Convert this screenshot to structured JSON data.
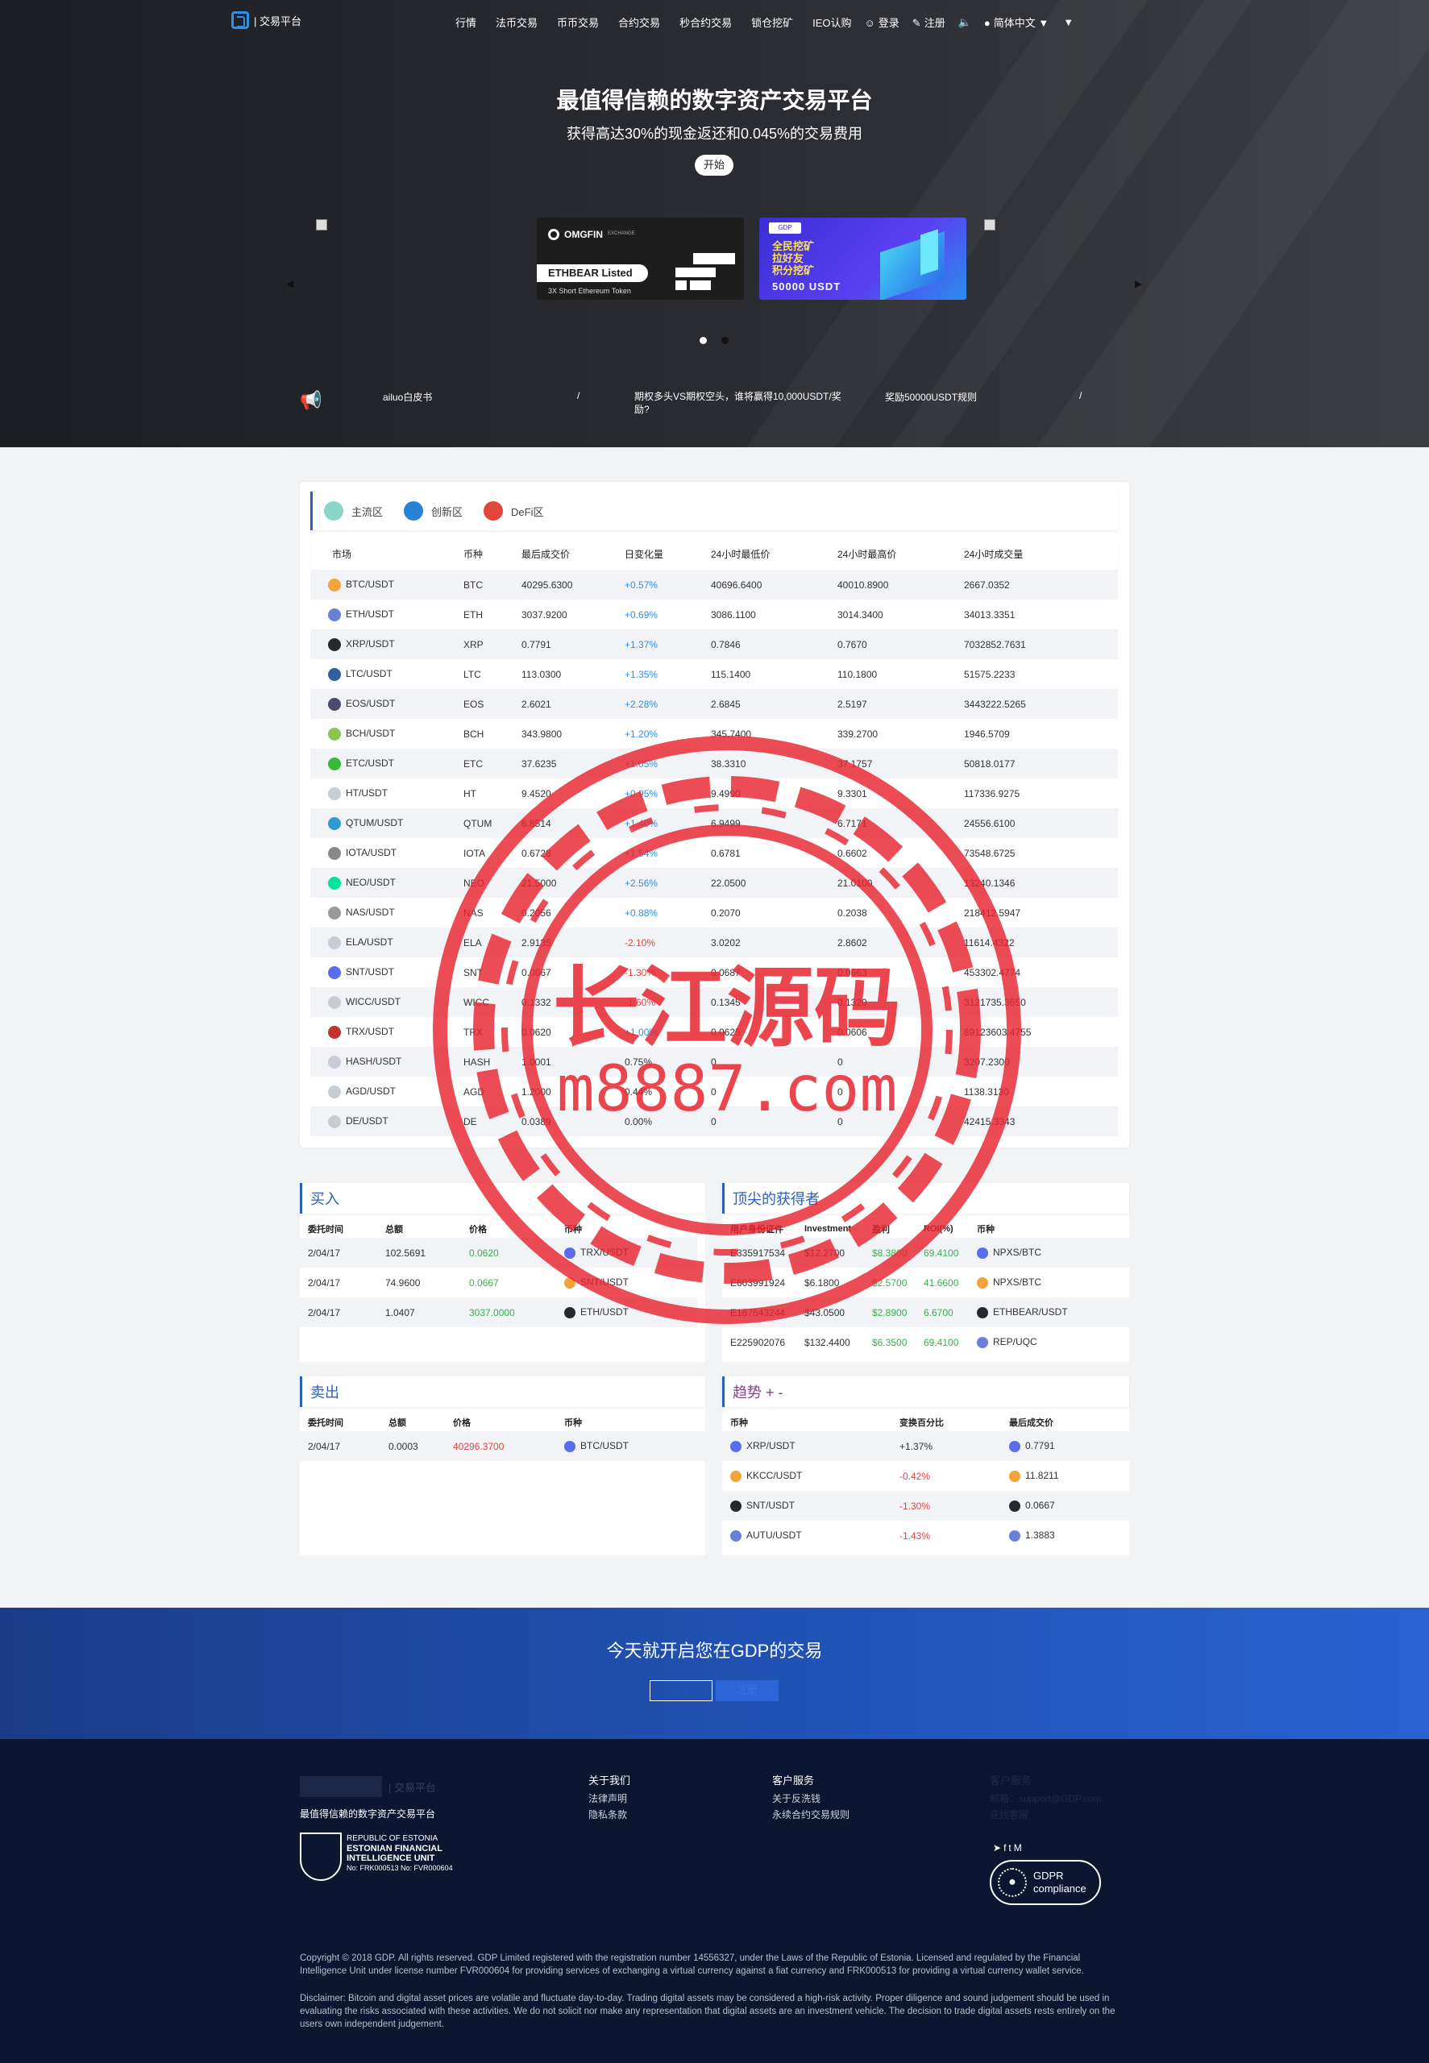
{
  "brand": {
    "name": "| 交易平台"
  },
  "nav": {
    "items": [
      "行情",
      "法币交易",
      "币币交易",
      "合约交易",
      "秒合约交易",
      "锁仓挖矿",
      "IEO认购"
    ],
    "login": "登录",
    "register": "注册",
    "language": "简体中文"
  },
  "hero": {
    "title": "最值得信赖的数字资产交易平台",
    "subtitle": "获得高达30%的现金返还和0.045%的交易费用",
    "start": "开始"
  },
  "banners": {
    "omgfin": {
      "brand": "OMGFIN",
      "tag": "EXCHANGE",
      "listed": "ETHBEAR Listed",
      "caption": "3X Short Ethereum Token"
    },
    "mining": {
      "line1": "全民挖矿",
      "line2": "拉好友",
      "line3": "积分挖矿",
      "line4": "50000 USDT",
      "badge": "GDP"
    }
  },
  "notices": [
    "ailuo白皮书",
    "/",
    "期权多头VS期权空头，谁将赢得10,000USDT/奖励?",
    "奖励50000USDT规则",
    "/"
  ],
  "zones": [
    "主流区",
    "创新区",
    "DeFi区"
  ],
  "market": {
    "headers": [
      "市场",
      "币种",
      "最后成交价",
      "日变化量",
      "24小时最低价",
      "24小时最高价",
      "24小时成交量"
    ],
    "rows": [
      {
        "pair": "BTC/USDT",
        "coin": "BTC",
        "last": "40295.6300",
        "change": "+0.57%",
        "low": "40696.6400",
        "high": "40010.8900",
        "vol": "2667.0352",
        "dir": "up",
        "color": "#f2a43a"
      },
      {
        "pair": "ETH/USDT",
        "coin": "ETH",
        "last": "3037.9200",
        "change": "+0.69%",
        "low": "3086.1100",
        "high": "3014.3400",
        "vol": "34013.3351",
        "dir": "up",
        "color": "#6c7fd8"
      },
      {
        "pair": "XRP/USDT",
        "coin": "XRP",
        "last": "0.7791",
        "change": "+1.37%",
        "low": "0.7846",
        "high": "0.7670",
        "vol": "7032852.7631",
        "dir": "up",
        "color": "#23292f"
      },
      {
        "pair": "LTC/USDT",
        "coin": "LTC",
        "last": "113.0300",
        "change": "+1.35%",
        "low": "115.1400",
        "high": "110.1800",
        "vol": "51575.2233",
        "dir": "up",
        "color": "#345d9d"
      },
      {
        "pair": "EOS/USDT",
        "coin": "EOS",
        "last": "2.6021",
        "change": "+2.28%",
        "low": "2.6845",
        "high": "2.5197",
        "vol": "3443222.5265",
        "dir": "up",
        "color": "#4b4b6b"
      },
      {
        "pair": "BCH/USDT",
        "coin": "BCH",
        "last": "343.9800",
        "change": "+1.20%",
        "low": "345.7400",
        "high": "339.2700",
        "vol": "1946.5709",
        "dir": "up",
        "color": "#8dc351"
      },
      {
        "pair": "ETC/USDT",
        "coin": "ETC",
        "last": "37.6235",
        "change": "+1.05%",
        "low": "38.3310",
        "high": "37.1757",
        "vol": "50818.0177",
        "dir": "up",
        "color": "#3ab83a"
      },
      {
        "pair": "HT/USDT",
        "coin": "HT",
        "last": "9.4520",
        "change": "+0.95%",
        "low": "9.4990",
        "high": "9.3301",
        "vol": "117336.9275",
        "dir": "up",
        "color": "#c8ccd4"
      },
      {
        "pair": "QTUM/USDT",
        "coin": "QTUM",
        "last": "6.8514",
        "change": "+1.40%",
        "low": "6.9499",
        "high": "6.7171",
        "vol": "24556.6100",
        "dir": "up",
        "color": "#2e9ad0"
      },
      {
        "pair": "IOTA/USDT",
        "coin": "IOTA",
        "last": "0.6728",
        "change": "+1.54%",
        "low": "0.6781",
        "high": "0.6602",
        "vol": "73548.6725",
        "dir": "up",
        "color": "#888"
      },
      {
        "pair": "NEO/USDT",
        "coin": "NEO",
        "last": "21.5000",
        "change": "+2.56%",
        "low": "22.0500",
        "high": "21.0100",
        "vol": "13240.1346",
        "dir": "up",
        "color": "#00e599"
      },
      {
        "pair": "NAS/USDT",
        "coin": "NAS",
        "last": "0.2056",
        "change": "+0.88%",
        "low": "0.2070",
        "high": "0.2038",
        "vol": "218412.5947",
        "dir": "up",
        "color": "#999"
      },
      {
        "pair": "ELA/USDT",
        "coin": "ELA",
        "last": "2.9135",
        "change": "-2.10%",
        "low": "3.0202",
        "high": "2.8602",
        "vol": "11614.4322",
        "dir": "down",
        "color": "#c8ccd4"
      },
      {
        "pair": "SNT/USDT",
        "coin": "SNT",
        "last": "0.0667",
        "change": "-1.30%",
        "low": "0.0687",
        "high": "0.0663",
        "vol": "453302.4774",
        "dir": "down",
        "color": "#5b6dee"
      },
      {
        "pair": "WICC/USDT",
        "coin": "WICC",
        "last": "0.1332",
        "change": "-1.60%",
        "low": "0.1345",
        "high": "0.1320",
        "vol": "3121735.3650",
        "dir": "down",
        "color": "#c8ccd4"
      },
      {
        "pair": "TRX/USDT",
        "coin": "TRX",
        "last": "0.0620",
        "change": "+1.00%",
        "low": "0.0625",
        "high": "0.0606",
        "vol": "89123603.4755",
        "dir": "up",
        "color": "#c0332f"
      },
      {
        "pair": "HASH/USDT",
        "coin": "HASH",
        "last": "1.0001",
        "change": "0.75%",
        "low": "0",
        "high": "0",
        "vol": "3207.2300",
        "dir": "none",
        "color": "#c8ccd4"
      },
      {
        "pair": "AGD/USDT",
        "coin": "AGD",
        "last": "1.2000",
        "change": "0.44%",
        "low": "0",
        "high": "0",
        "vol": "1138.3130",
        "dir": "none",
        "color": "#c8ccd4"
      },
      {
        "pair": "DE/USDT",
        "coin": "DE",
        "last": "0.0389",
        "change": "0.00%",
        "low": "0",
        "high": "0",
        "vol": "42415.3343",
        "dir": "none",
        "color": "#c8ccd4"
      }
    ]
  },
  "buy": {
    "title": "买入",
    "headers": [
      "委托时间",
      "总额",
      "价格",
      "币种"
    ],
    "rows": [
      [
        "2/04/17",
        "102.5691",
        "0.0620",
        "TRX/USDT"
      ],
      [
        "2/04/17",
        "74.9600",
        "0.0667",
        "SNT/USDT"
      ],
      [
        "2/04/17",
        "1.0407",
        "3037.0000",
        "ETH/USDT"
      ]
    ]
  },
  "top": {
    "title": "顶尖的获得者",
    "headers": [
      "用户身份证件",
      "Investment",
      "盈利",
      "ROI(%)",
      "币种"
    ],
    "rows": [
      [
        "E335917534",
        "$12.2700",
        "$8.3800",
        "69.4100",
        "NPXS/BTC"
      ],
      [
        "E603991924",
        "$6.1800",
        "$2.5700",
        "41.6600",
        "NPXS/BTC"
      ],
      [
        "E167643244",
        "$43.0500",
        "$2.8900",
        "6.6700",
        "ETHBEAR/USDT"
      ],
      [
        "E225902076",
        "$132.4400",
        "$6.3500",
        "69.4100",
        "REP/UQC"
      ]
    ]
  },
  "sell": {
    "title": "卖出",
    "headers": [
      "委托时间",
      "总额",
      "价格",
      "币种"
    ],
    "rows": [
      [
        "2/04/17",
        "0.0003",
        "40296.3700",
        "BTC/USDT"
      ]
    ]
  },
  "trend": {
    "title": "趋势 + -",
    "headers": [
      "币种",
      "变换百分比",
      "最后成交价"
    ],
    "rows": [
      [
        "XRP/USDT",
        "+1.37%",
        "0.7791"
      ],
      [
        "KKCC/USDT",
        "-0.42%",
        "11.8211"
      ],
      [
        "SNT/USDT",
        "-1.30%",
        "0.0667"
      ],
      [
        "AUTU/USDT",
        "-1.43%",
        "1.3883"
      ]
    ]
  },
  "cta": {
    "text": "今天就开启您在GDP的交易",
    "login": "登录",
    "register": "注册"
  },
  "footer": {
    "tagline": "最值得信赖的数字资产交易平台",
    "brand": "| 交易平台",
    "fiu": [
      "REPUBLIC OF ESTONIA",
      "ESTONIAN FINANCIAL",
      "INTELLIGENCE UNIT",
      "No: FRK000513  No: FVR000604"
    ],
    "about": {
      "title": "关于我们",
      "links": [
        "法律声明",
        "隐私条款"
      ]
    },
    "service": {
      "title": "客户服务",
      "links": [
        "关于反洗钱",
        "永续合约交易规则"
      ]
    },
    "contact": {
      "title": "客户服务",
      "email": "邮箱：support@GDP.com",
      "online": "在线客服"
    },
    "gdpr": "GDPR compliance",
    "copyright": "Copyright © 2018 GDP. All rights reserved. GDP Limited registered with the registration number 14556327, under the Laws of the Republic of Estonia. Licensed and regulated by the Financial Intelligence Unit under license number FVR000604 for providing services of exchanging a virtual currency against a fiat currency and FRK000513 for providing a virtual currency wallet service.",
    "disclaimer": "Disclaimer: Bitcoin and digital asset prices are volatile and fluctuate day-to-day. Trading digital assets may be considered a high-risk activity. Proper diligence and sound judgement should be used in evaluating the risks associated with these activities. We do not solicit nor make any representation that digital assets are an investment vehicle. The decision to trade digital assets rests entirely on the users own independent judgement."
  },
  "watermark": {
    "line1": "长江源码",
    "line2": "m8887.com"
  },
  "colors": {
    "accent": "#2c5fb8",
    "up": "#2f8fe6",
    "down": "#e2443f",
    "green": "#34b34a",
    "stamp": "#e8252f"
  }
}
